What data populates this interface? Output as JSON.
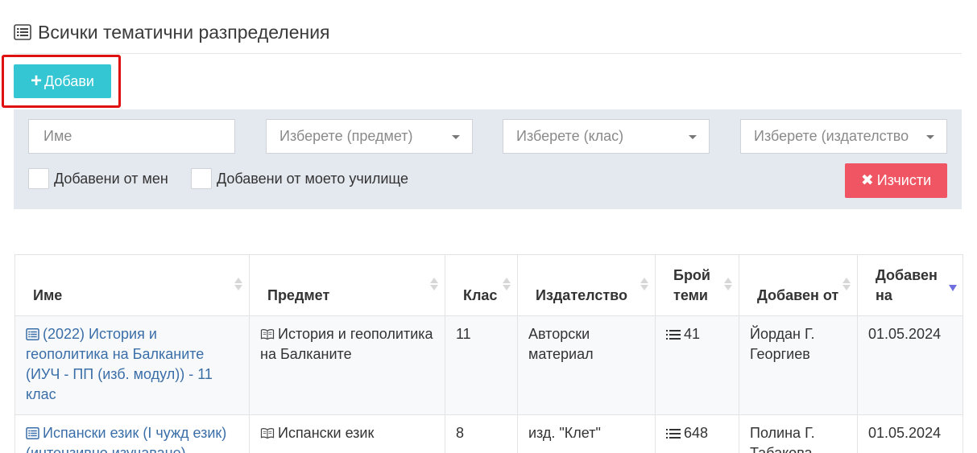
{
  "page": {
    "title": "Всички тематични разпределения"
  },
  "toolbar": {
    "add_label": "Добави"
  },
  "filters": {
    "name_placeholder": "Име",
    "subject_placeholder": "Изберете (предмет)",
    "class_placeholder": "Изберете (клас)",
    "publisher_placeholder": "Изберете (издателство",
    "added_by_me_label": "Добавени от мен",
    "added_by_school_label": "Добавени от моето училище",
    "clear_label": "Изчисти"
  },
  "table": {
    "headers": {
      "name": "Име",
      "subject": "Предмет",
      "class": "Клас",
      "publisher": "Издателство",
      "topics": "Брой теми",
      "added_by": "Добавен от",
      "added_on": "Добавен на"
    },
    "rows": [
      {
        "name": "(2022) История и геополитика на Балканите (ИУЧ - ПП (изб. модул)) - 11 клас",
        "subject": "История и геополитика на Балканите",
        "class": "11",
        "publisher": "Авторски материал",
        "topics": "41",
        "added_by": "Йордан Г. Георгиев",
        "added_on": "01.05.2024"
      },
      {
        "name": "Испански език (I чужд език) (интензивно изучаване)",
        "subject": "Испански език",
        "class": "8",
        "publisher": "изд. \"Клет\"",
        "topics": "648",
        "added_by": "Полина Г. Табакова",
        "added_on": "01.05.2024"
      }
    ]
  },
  "colors": {
    "add_button": "#34c6d3",
    "clear_button": "#ef5562",
    "highlight": "#e01010",
    "link": "#3a6ea8",
    "filter_panel": "#e4e8ef"
  }
}
